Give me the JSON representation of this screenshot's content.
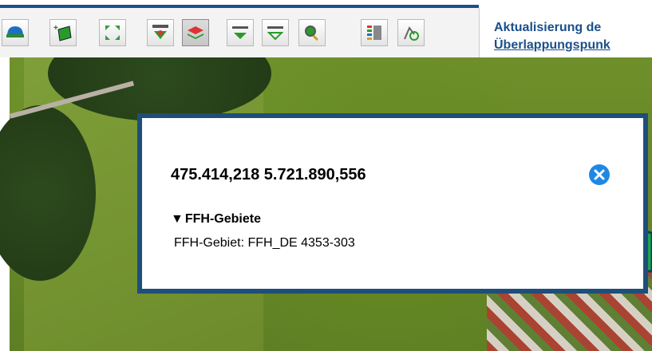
{
  "toolbar": {
    "buttons": [
      {
        "name": "layer-tool-button",
        "icon": "helmet-icon"
      },
      {
        "name": "add-polygon-button",
        "icon": "add-polygon-icon"
      },
      {
        "name": "zoom-extent-button",
        "icon": "zoom-extent-icon"
      },
      {
        "name": "measure-area-button",
        "icon": "measure-area-icon"
      },
      {
        "name": "layers-button",
        "icon": "stacked-layers-icon",
        "active": true
      },
      {
        "name": "measure-distance-button",
        "icon": "measure-distance-icon"
      },
      {
        "name": "measure-profile-button",
        "icon": "measure-profile-icon"
      },
      {
        "name": "search-button",
        "icon": "magnifier-icon"
      },
      {
        "name": "legend-button",
        "icon": "legend-icon"
      },
      {
        "name": "route-button",
        "icon": "route-icon"
      }
    ]
  },
  "info_panel": {
    "title_line1": "Aktualisierung de",
    "title_line2": "Überlappungspunk"
  },
  "popup": {
    "coordinates": "475.414,218 5.721.890,556",
    "section_title": "FFH-Gebiete",
    "section_toggle": "▼",
    "value": "FFH-Gebiet: FFH_DE 4353-303",
    "close_icon": "close-icon"
  },
  "colors": {
    "popup_border": "#1f4e7a",
    "close_button": "#1e88e5",
    "annotation_green": "#1aa64a",
    "info_text": "#1b4f8a"
  }
}
